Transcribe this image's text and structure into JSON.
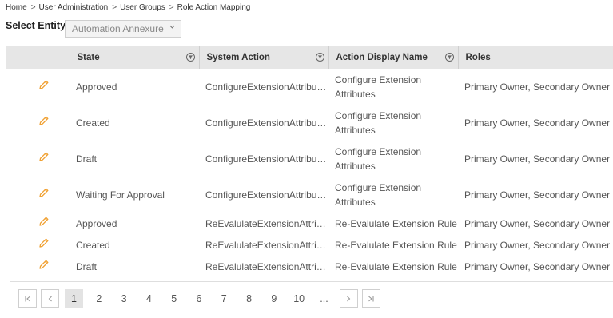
{
  "breadcrumb": [
    "Home",
    "User Administration",
    "User Groups",
    "Role Action Mapping"
  ],
  "breadcrumb_separator": ">",
  "entity": {
    "label": "Select Entity",
    "value": "Automation Annexure"
  },
  "columns": [
    "",
    "State",
    "System Action",
    "Action Display Name",
    "Roles"
  ],
  "rows": [
    {
      "state": "Approved",
      "system_action": "ConfigureExtensionAttributes",
      "display_name": "Configure Extension Attributes",
      "roles": "Primary Owner, Secondary Owner"
    },
    {
      "state": "Created",
      "system_action": "ConfigureExtensionAttributes",
      "display_name": "Configure Extension Attributes",
      "roles": "Primary Owner, Secondary Owner"
    },
    {
      "state": "Draft",
      "system_action": "ConfigureExtensionAttributes",
      "display_name": "Configure Extension Attributes",
      "roles": "Primary Owner, Secondary Owner"
    },
    {
      "state": "Waiting For Approval",
      "system_action": "ConfigureExtensionAttributes",
      "display_name": "Configure Extension Attributes",
      "roles": "Primary Owner, Secondary Owner"
    },
    {
      "state": "Approved",
      "system_action": "ReEvalulateExtensionAttribu...",
      "display_name": "Re-Evalulate Extension Rule",
      "roles": "Primary Owner, Secondary Owner"
    },
    {
      "state": "Created",
      "system_action": "ReEvalulateExtensionAttribu...",
      "display_name": "Re-Evalulate Extension Rule",
      "roles": "Primary Owner, Secondary Owner"
    },
    {
      "state": "Draft",
      "system_action": "ReEvalulateExtensionAttribu...",
      "display_name": "Re-Evalulate Extension Rule",
      "roles": "Primary Owner, Secondary Owner"
    }
  ],
  "pagination": {
    "first": "K",
    "prev": "<",
    "pages": [
      "1",
      "2",
      "3",
      "4",
      "5",
      "6",
      "7",
      "8",
      "9",
      "10",
      "..."
    ],
    "current": "1",
    "next": ">",
    "last": ">|"
  },
  "colors": {
    "edit_icon": "#f0a030",
    "header_bg": "#e6e6e6",
    "active_page_bg": "#e3e3e3"
  },
  "icons": {
    "edit": "pencil-icon",
    "filter": "filter-icon",
    "dropdown": "chevron-down-icon"
  }
}
